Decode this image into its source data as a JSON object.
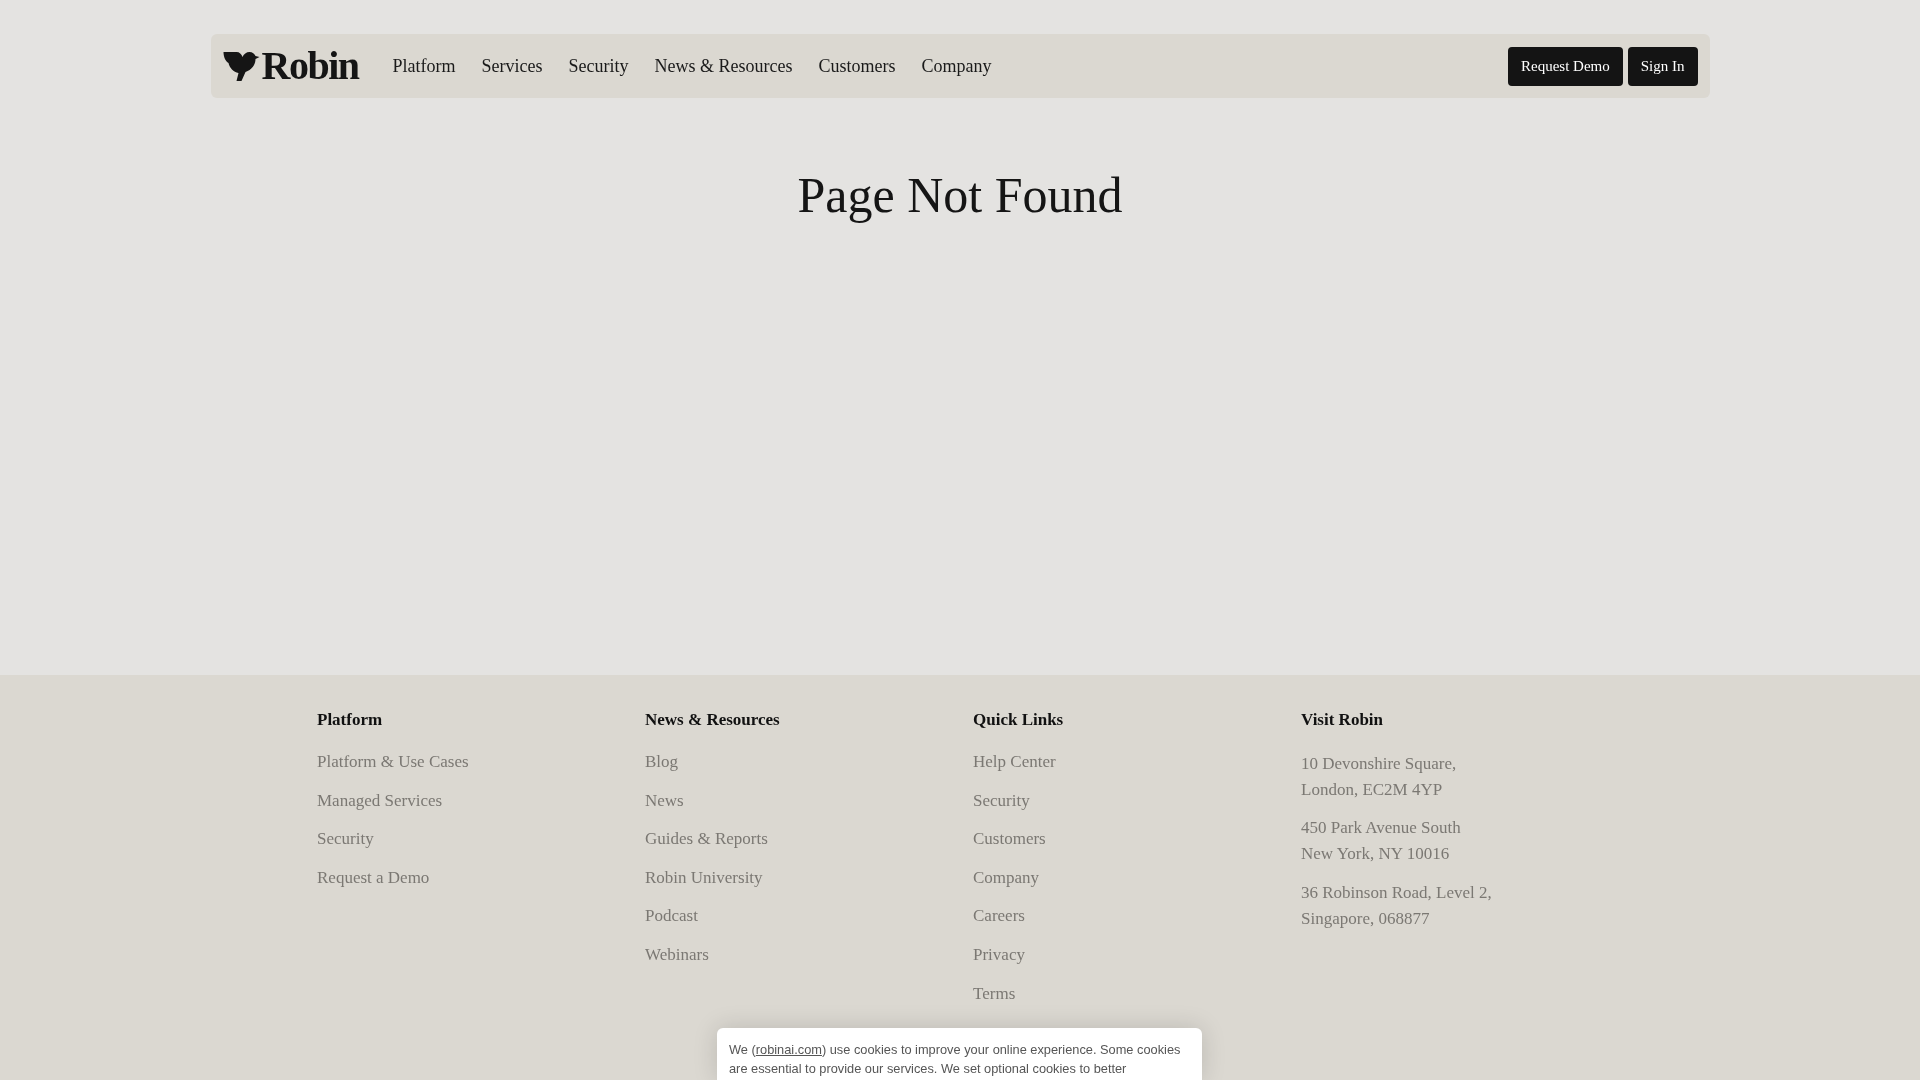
{
  "header": {
    "logo": "Robin",
    "nav": [
      "Platform",
      "Services",
      "Security",
      "News & Resources",
      "Customers",
      "Company"
    ],
    "buttons": [
      "Request Demo",
      "Sign In"
    ]
  },
  "main": {
    "title": "Page Not Found"
  },
  "footer": {
    "columns": [
      {
        "kind": "links",
        "heading": "Platform",
        "items": [
          "Platform & Use Cases",
          "Managed Services",
          "Security",
          "Request a Demo"
        ]
      },
      {
        "kind": "links",
        "heading": "News & Resources",
        "items": [
          "Blog",
          "News",
          "Guides & Reports",
          "Robin University",
          "Podcast",
          "Webinars"
        ]
      },
      {
        "kind": "links",
        "heading": "Quick Links",
        "items": [
          "Help Center",
          "Security",
          "Customers",
          "Company",
          "Careers",
          "Privacy",
          "Terms"
        ]
      },
      {
        "kind": "addresses",
        "heading": "Visit Robin",
        "addresses": [
          [
            "10 Devonshire Square,",
            "London, EC2M 4YP"
          ],
          [
            "450 Park Avenue South",
            "New York, NY 10016"
          ],
          [
            "36 Robinson Road, Level 2,",
            "Singapore, 068877"
          ]
        ]
      }
    ]
  },
  "cookie_banner": {
    "text_before": "We (",
    "link": "robinai.com",
    "text_after": ") use cookies to improve your online experience. Some cookies are essential to provide our services. We set optional cookies to better"
  }
}
